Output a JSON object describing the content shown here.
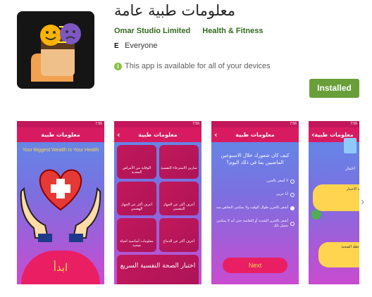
{
  "app": {
    "title": "معلومات طبية عامة",
    "developer": "Omar Studio Limited",
    "category": "Health & Fitness",
    "content_rating": "Everyone",
    "availability": "This app is available for all of your devices",
    "install_label": "Installed"
  },
  "screenshots": {
    "s1": {
      "title": "معلومات طبية",
      "subtitle": "Your Biggest Wealth Is Your Health",
      "start_label": "ابدأ"
    },
    "s2": {
      "title": "معلومات طبية",
      "tiles": [
        "الوقاية من الأمراض المعدية",
        "تمارين الاسترخاء النفسية",
        "أعرف أكثر عن الجهاز الهضمي",
        "أعرف أكثر عن الجهاز التنفسي",
        "معلومات أساسية لحياة صحية",
        "أعرف أكثر عن الدماغ"
      ],
      "wide_tile": "اختبار الصحة النفسية السريع"
    },
    "s3": {
      "title": "معلومات طبية",
      "question": "كيف كان شعورك خلال الاسبوعين الماضيين بما في ذلك اليوم؟",
      "options": [
        "لا أشعر بالحزن",
        "أنا حزين",
        "أشعر بالحزن طوال الوقت ولا يمكنني التخلص منه",
        "أشعر بالحزن الشديد أو التعاسة حتى أنه لا يمكنني تحمل ذلك"
      ],
      "next_label": "Next"
    },
    "s4": {
      "title": "معلومات طبية",
      "label": "اختبار",
      "bubbles": [
        "نتيجة الاختبار",
        "ملاحظة الصحية"
      ]
    }
  },
  "colors": {
    "install_green": "#689f38",
    "developer_green": "#33691e",
    "appbar_pink": "#d81b60"
  }
}
